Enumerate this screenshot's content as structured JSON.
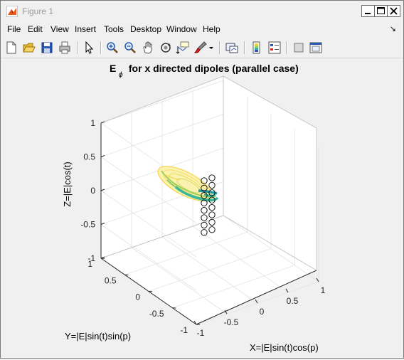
{
  "window": {
    "title": "Figure 1"
  },
  "menu": {
    "items": [
      "File",
      "Edit",
      "View",
      "Insert",
      "Tools",
      "Desktop",
      "Window",
      "Help"
    ],
    "extra": "↘"
  },
  "toolbar": {
    "buttons": [
      "new-figure",
      "open-file",
      "save-figure",
      "print-figure",
      "edit-plot",
      "zoom-in",
      "zoom-out",
      "pan",
      "rotate-3d",
      "data-cursor",
      "brush",
      "link-plot",
      "insert-colorbar",
      "insert-legend",
      "hide-plot-tools",
      "show-plot-tools"
    ]
  },
  "chart_data": {
    "type": "3d-surface",
    "title_main": "E",
    "title_sub": "ϕ",
    "title_rest": " for x directed dipoles (parallel case)",
    "xlabel": "X=|E|sin(t)cos(p)",
    "ylabel": "Y=|E|sin(t)sin(p)",
    "zlabel": "Z=|E|cos(t)",
    "xticks": [
      "-1",
      "-0.5",
      "0",
      "0.5",
      "1"
    ],
    "yticks": [
      "-1",
      "-0.5",
      "0",
      "0.5",
      "1"
    ],
    "zticks": [
      "-1",
      "-0.5",
      "0",
      "0.5",
      "1"
    ],
    "xlim": [
      -1,
      1
    ],
    "ylim": [
      -1,
      1
    ],
    "zlim": [
      -1,
      1
    ],
    "grid": true,
    "surface_colors": [
      "#f2d44e",
      "#9fcf5c",
      "#37b89c",
      "#1f9aa8"
    ],
    "marker_color": "#000000",
    "markers": "two vertical columns of open circles (dipole array positions)"
  }
}
